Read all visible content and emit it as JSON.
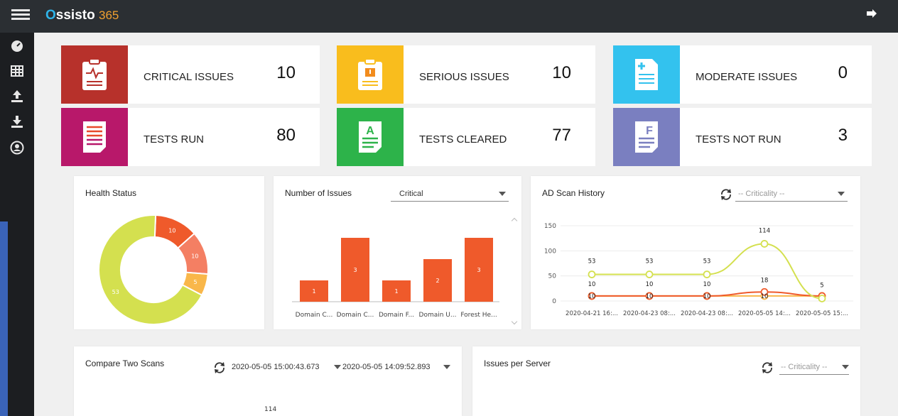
{
  "app": {
    "logo_main": "ssisto",
    "logo_o": "O",
    "logo_num": "3",
    "logo_suffix": "65"
  },
  "sidebar": {
    "items": [
      "dashboard",
      "table",
      "upload",
      "download",
      "account"
    ]
  },
  "kpis": [
    {
      "label": "CRITICAL ISSUES",
      "value": "10",
      "color": "#b7312b"
    },
    {
      "label": "SERIOUS ISSUES",
      "value": "10",
      "color": "#f9bd1d"
    },
    {
      "label": "MODERATE ISSUES",
      "value": "0",
      "color": "#33c2ee"
    },
    {
      "label": "TESTS RUN",
      "value": "80",
      "color": "#b8186a"
    },
    {
      "label": "TESTS CLEARED",
      "value": "77",
      "color": "#2db34a"
    },
    {
      "label": "TESTS NOT RUN",
      "value": "3",
      "color": "#7a7fc0"
    }
  ],
  "health": {
    "title": "Health Status",
    "chart_data": {
      "type": "pie",
      "values": [
        10,
        10,
        5,
        53
      ],
      "labels": [
        "10",
        "10",
        "5",
        "53"
      ],
      "colors": [
        "#ef5a2b",
        "#f47f63",
        "#f9b74a",
        "#d4e04f"
      ]
    }
  },
  "issues": {
    "title": "Number of Issues",
    "select": "Critical",
    "chart_data": {
      "type": "bar",
      "categories": [
        "Domain C...",
        "Domain C...",
        "Domain F...",
        "Domain U...",
        "Forest He..."
      ],
      "values": [
        1,
        3,
        1,
        2,
        3
      ],
      "ylim": [
        0,
        3.3
      ],
      "color": "#ef5a2b"
    }
  },
  "ad_scan": {
    "title": "AD Scan History",
    "select": "-- Criticality --",
    "chart_data": {
      "type": "line",
      "categories": [
        "2020-04-21 16:...",
        "2020-04-23 08:...",
        "2020-04-23 08:...",
        "2020-05-05 14:...",
        "2020-05-05 15:..."
      ],
      "yticks": [
        0,
        50,
        100,
        150
      ],
      "ylim": [
        0,
        150
      ],
      "series": [
        {
          "values": [
            53,
            53,
            53,
            114,
            5
          ],
          "color": "#d4e04f"
        },
        {
          "values": [
            10,
            10,
            10,
            18,
            10
          ],
          "color": "#ef5a2b"
        },
        {
          "values": [
            10,
            10,
            10,
            10,
            10
          ],
          "color": "#f9b74a"
        }
      ],
      "labels_top": [
        "53",
        "53",
        "53",
        "114",
        "5"
      ],
      "labels_mid": [
        "10",
        "10",
        "10",
        "18",
        ""
      ],
      "labels_bottom": [
        "10",
        "10",
        "10",
        "10",
        ""
      ]
    }
  },
  "compare": {
    "title": "Compare Two Scans",
    "date1": "2020-05-05 15:00:43.673",
    "date2": "2020-05-05 14:09:52.893",
    "value": "114"
  },
  "server": {
    "title": "Issues per Server",
    "select": "-- Criticality --"
  }
}
